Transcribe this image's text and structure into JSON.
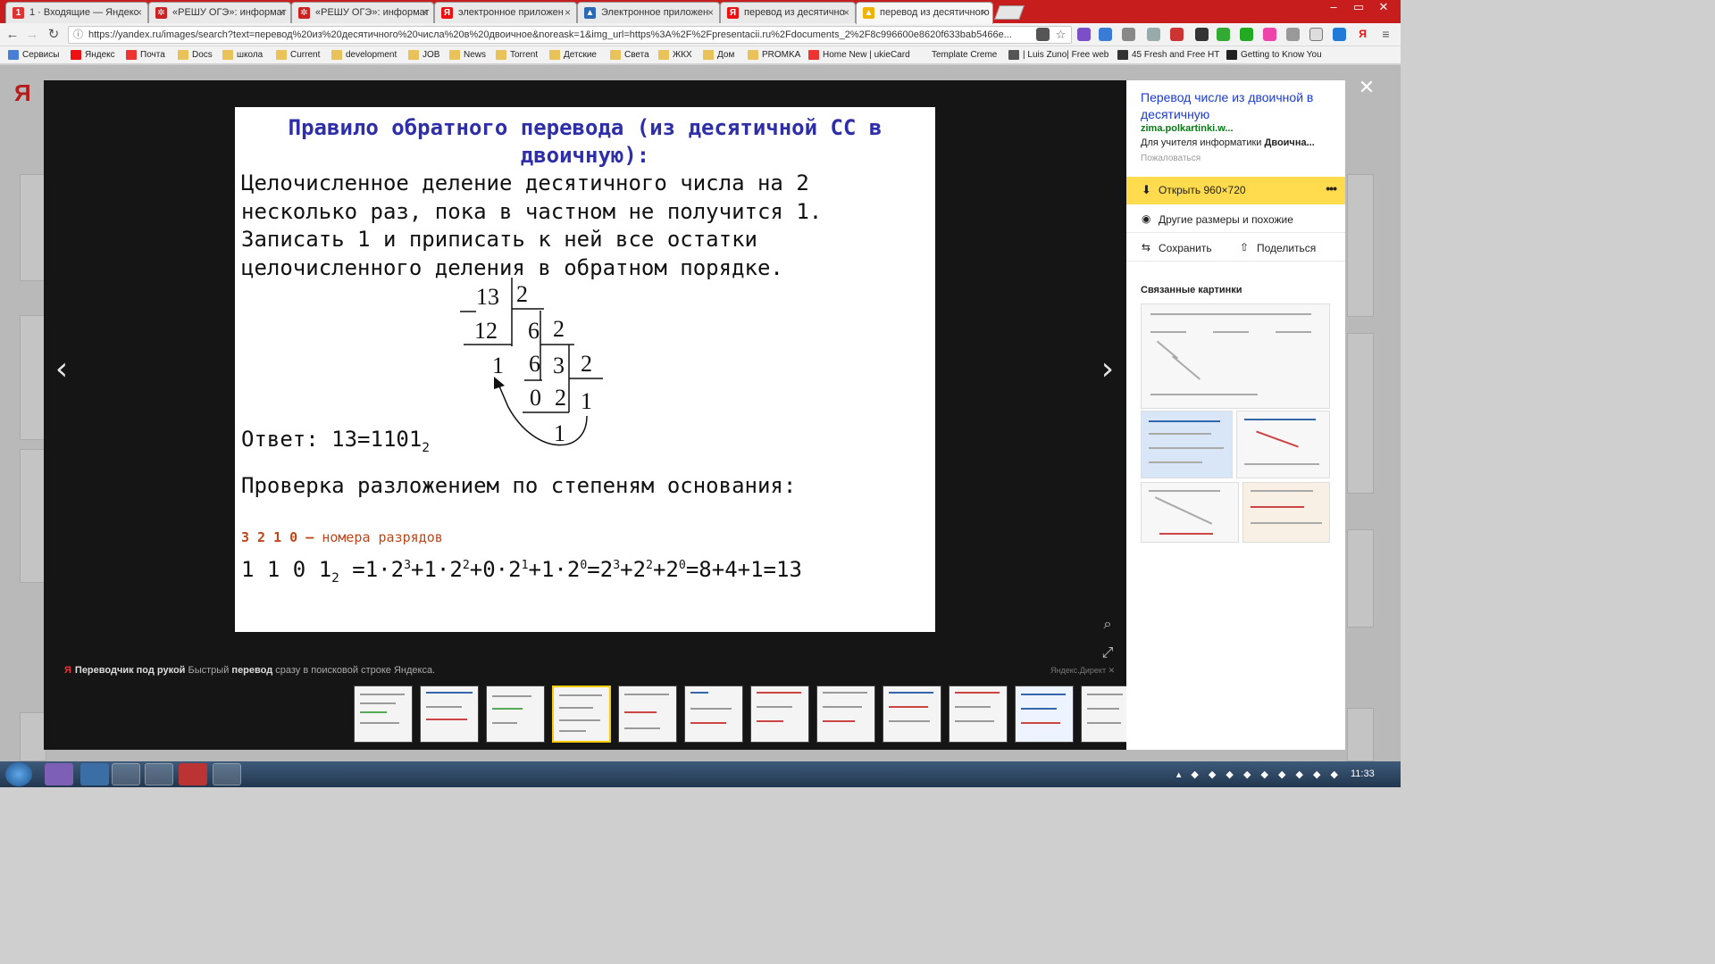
{
  "browser": {
    "tabs": [
      {
        "title": "1 · Входящие — Яндекс",
        "fav_color": "#d33"
      },
      {
        "title": "«РЕШУ ОГЭ»: информат",
        "fav_color": "#c22"
      },
      {
        "title": "«РЕШУ ОГЭ»: информат",
        "fav_color": "#c22"
      },
      {
        "title": "электронное приложен",
        "fav_color": "#e11"
      },
      {
        "title": "Электронное приложен",
        "fav_color": "#2a6ab5"
      },
      {
        "title": "перевод из десятично",
        "fav_color": "#e11"
      },
      {
        "title": "перевод из десятичного",
        "fav_color": "#f0b400"
      }
    ],
    "url": "https://yandex.ru/images/search?text=перевод%20из%20десятичного%20числа%20в%20двоичное&noreask=1&img_url=https%3A%2F%2Fpresentacii.ru%2Fdocuments_2%2F8c996600e8620f633bab5466e...",
    "bookmarks": [
      "Сервисы",
      "Яндекс",
      "Почта",
      "Docs",
      "школа",
      "Current",
      "development",
      "JOB",
      "News",
      "Torrent",
      "Детские",
      "Света",
      "ЖКХ",
      "Дом",
      "PROMKA",
      "Home New | ukieCard",
      "Template Creme",
      "| Luis Zuno| Free web",
      "45 Fresh and Free HT",
      "Getting to Know You"
    ]
  },
  "slide": {
    "title": "Правило обратного перевода (из десятичной СС в двоичную):",
    "rule": "Целочисленное деление десятичного числа на 2\nнесколько раз, пока в частном не получится 1.\nЗаписать 1 и приписать к ней все остатки\nцелочисленного деления в обратном порядке.",
    "answer_prefix": "Ответ: 13=1101",
    "answer_base": "2",
    "check": "Проверка разложением по степеням основания:",
    "digit_positions": "3 2 1 0 –",
    "digit_note": "номера разрядов",
    "formula_digits": "1 1 0 1",
    "formula_base": "2",
    "division": {
      "dividend": "13",
      "divisor": "2",
      "sub1": "12",
      "q1": "6",
      "d2": "2",
      "r1": "1",
      "sub2": "6",
      "q2": "3",
      "d3": "2",
      "r2": "0",
      "sub3": "2",
      "q3": "1",
      "r3": "1"
    }
  },
  "viewer": {
    "ad_brand": "Я",
    "ad_title": "Переводчик под рукой",
    "ad_text_1": "Быстрый",
    "ad_bold": "перевод",
    "ad_text_2": "сразу в поисковой строке Яндекса.",
    "ad_right": "Яндекс.Директ"
  },
  "panel": {
    "title": "Перевод числе из двоичной в десятичную",
    "domain": "zima.polkartinki.w...",
    "desc_prefix": "Для учителя информатики",
    "desc_bold": "Двоична...",
    "complain": "Пожаловаться",
    "open_label": "Открыть",
    "open_size": "960×720",
    "other_sizes": "Другие размеры и похожие",
    "save": "Сохранить",
    "share": "Поделиться",
    "related": "Связанные картинки"
  },
  "taskbar": {
    "clock": "11:33"
  },
  "colors": {
    "accent": "#ffdb4d",
    "slide_title": "#2e2ea8",
    "note": "#c0461a",
    "link": "#1a3ad6",
    "domain": "#0a7a16"
  }
}
